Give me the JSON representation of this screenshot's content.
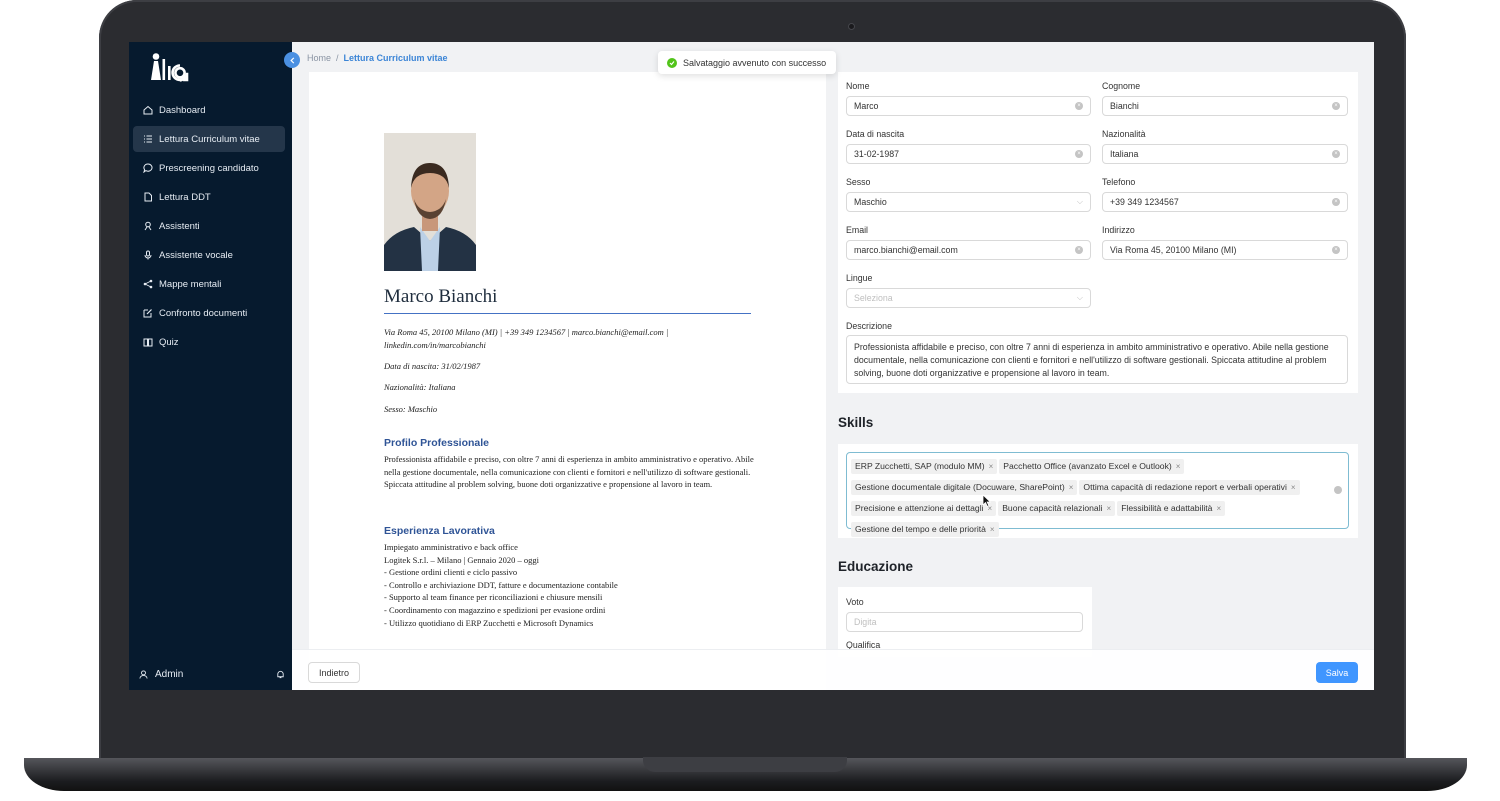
{
  "brand": {
    "logo_text": "lia"
  },
  "sidebar": {
    "items": [
      {
        "label": "Dashboard",
        "icon": "home-icon"
      },
      {
        "label": "Lettura Curriculum vitae",
        "icon": "list-icon",
        "active": true
      },
      {
        "label": "Prescreening candidato",
        "icon": "chat-icon"
      },
      {
        "label": "Lettura DDT",
        "icon": "file-icon"
      },
      {
        "label": "Assistenti",
        "icon": "assistant-icon"
      },
      {
        "label": "Assistente vocale",
        "icon": "microphone-icon"
      },
      {
        "label": "Mappe mentali",
        "icon": "share-icon"
      },
      {
        "label": "Confronto documenti",
        "icon": "edit-icon"
      },
      {
        "label": "Quiz",
        "icon": "book-icon"
      }
    ],
    "user_label": "Admin"
  },
  "breadcrumb": {
    "home": "Home",
    "separator": "/",
    "current": "Lettura Curriculum vitae"
  },
  "toast": {
    "message": "Salvataggio avvenuto con successo"
  },
  "cv": {
    "name": "Marco Bianchi",
    "contact": "Via Roma 45, 20100 Milano (MI) | +39 349 1234567 | marco.bianchi@email.com | linkedin.com/in/marcobianchi",
    "birth": "Data di nascita: 31/02/1987",
    "nationality": "Nazionalità: Italiana",
    "sex": "Sesso: Maschio",
    "profile_title": "Profilo Professionale",
    "profile_text": "Professionista affidabile e preciso, con oltre 7 anni di esperienza in ambito amministrativo e operativo. Abile nella gestione documentale, nella comunicazione con clienti e fornitori e nell'utilizzo di software gestionali. Spiccata attitudine al problem solving, buone doti organizzative e propensione al lavoro in team.",
    "experience_title": "Esperienza Lavorativa",
    "experience_lines": [
      "Impiegato amministrativo e back office",
      "Logitek S.r.l. – Milano | Gennaio 2020 – oggi",
      "- Gestione ordini clienti e ciclo passivo",
      "- Controllo e archiviazione DDT, fatture e documentazione contabile",
      "- Supporto al team finance per riconciliazioni e chiusure mensili",
      "- Coordinamento con magazzino e spedizioni per evasione ordini",
      "- Utilizzo quotidiano di ERP Zucchetti e Microsoft Dynamics"
    ]
  },
  "form": {
    "nome": {
      "label": "Nome",
      "value": "Marco"
    },
    "cognome": {
      "label": "Cognome",
      "value": "Bianchi"
    },
    "nascita": {
      "label": "Data di nascita",
      "value": "31-02-1987"
    },
    "nazionalita": {
      "label": "Nazionalità",
      "value": "Italiana"
    },
    "sesso": {
      "label": "Sesso",
      "value": "Maschio"
    },
    "telefono": {
      "label": "Telefono",
      "value": "+39 349 1234567"
    },
    "email": {
      "label": "Email",
      "value": "marco.bianchi@email.com"
    },
    "indirizzo": {
      "label": "Indirizzo",
      "value": "Via Roma 45, 20100 Milano (MI)"
    },
    "lingue": {
      "label": "Lingue",
      "placeholder": "Seleziona"
    },
    "descrizione": {
      "label": "Descrizione",
      "value": "Professionista affidabile e preciso, con oltre 7 anni di esperienza in ambito amministrativo e operativo. Abile nella gestione documentale, nella comunicazione con clienti e fornitori e nell'utilizzo di software gestionali. Spiccata attitudine al problem solving, buone doti organizzative e propensione al lavoro in team."
    }
  },
  "skills": {
    "title": "Skills",
    "tags": [
      "ERP Zucchetti, SAP (modulo MM)",
      "Pacchetto Office (avanzato Excel e Outlook)",
      "Gestione documentale digitale (Docuware, SharePoint)",
      "Ottima capacità di redazione report e verbali operativi",
      "Precisione e attenzione ai dettagli",
      "Buone capacità relazionali",
      "Flessibilità e adattabilità",
      "Gestione del tempo e delle priorità"
    ]
  },
  "education": {
    "title": "Educazione",
    "voto_label": "Voto",
    "voto_placeholder": "Digita",
    "qualifica_label": "Qualifica"
  },
  "actions": {
    "back": "Indietro",
    "save": "Salva"
  },
  "colors": {
    "sidebar_bg": "#061a2e",
    "accent": "#4096ff",
    "success": "#52c41a",
    "cv_heading": "#2f5496"
  }
}
